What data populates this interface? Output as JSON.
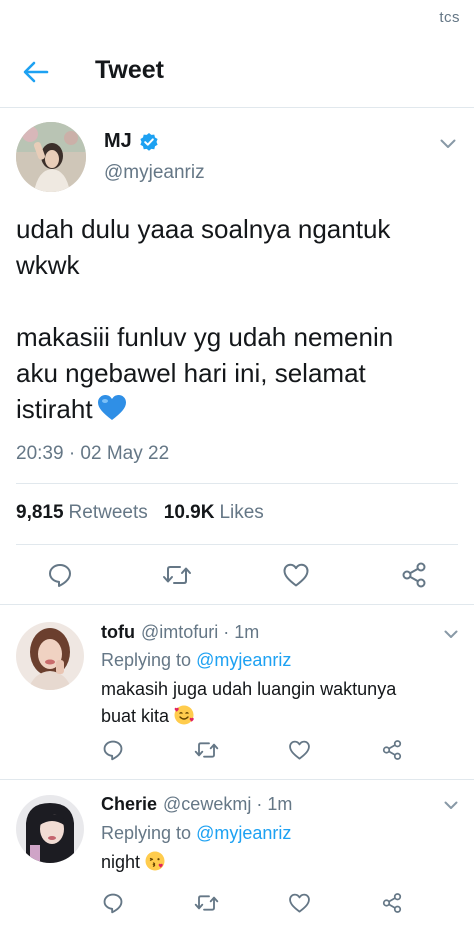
{
  "status_bar": {
    "watermark": "tcs"
  },
  "header": {
    "title": "Tweet"
  },
  "main_tweet": {
    "display_name": "MJ",
    "handle": "@myjeanriz",
    "text_line1": "udah dulu yaaa soalnya ngantuk",
    "text_line2": "wkwk",
    "text_line3": "makasiii funluv yg udah nemenin",
    "text_line4": "aku ngebawel hari ini, selamat",
    "text_line5": "istiraht",
    "timestamp": "20:39 · 02 May 22",
    "retweets_count": "9,815",
    "retweets_label": "Retweets",
    "likes_count": "10.9K",
    "likes_label": "Likes"
  },
  "replies": [
    {
      "name": "tofu",
      "handle": "@imtofuri",
      "separator": "·",
      "time": "1m",
      "replying_label": "Replying to",
      "replying_to": "@myjeanriz",
      "text_line1": "makasih juga udah luangin waktunya",
      "text_line2": "buat kita"
    },
    {
      "name": "Cherie",
      "handle": "@cewekmj",
      "separator": "·",
      "time": "1m",
      "replying_label": "Replying to",
      "replying_to": "@myjeanriz",
      "text_line1": "night"
    }
  ],
  "colors": {
    "accent": "#1da1f2",
    "text": "#14171a",
    "secondary": "#657786",
    "divider": "#e1e8ed",
    "heart_emoji": "#2f8fe6"
  },
  "icons": {
    "back": "arrow-left-icon",
    "verified": "verified-badge-icon",
    "caret": "chevron-down-icon",
    "reply": "comment-icon",
    "retweet": "retweet-icon",
    "like": "heart-icon",
    "share": "share-icon"
  }
}
